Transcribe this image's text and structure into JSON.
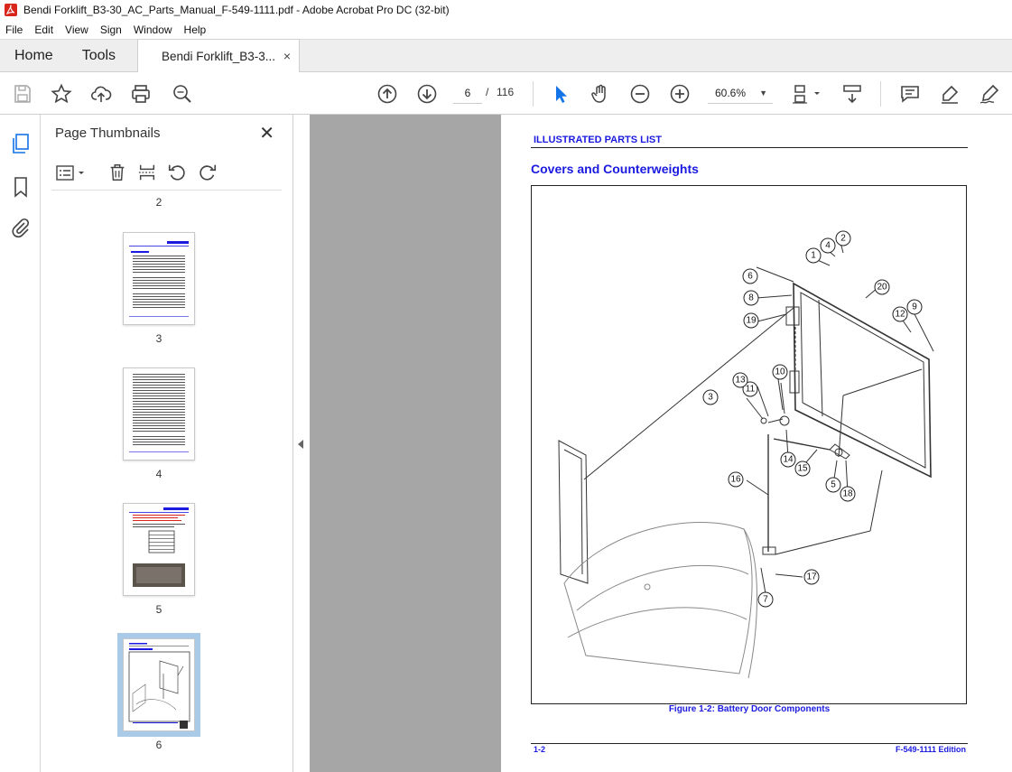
{
  "window": {
    "title": "Bendi Forklift_B3-30_AC_Parts_Manual_F-549-1111.pdf - Adobe Acrobat Pro DC (32-bit)"
  },
  "menu": [
    "File",
    "Edit",
    "View",
    "Sign",
    "Window",
    "Help"
  ],
  "tabs": {
    "home": "Home",
    "tools": "Tools",
    "document": "Bendi Forklift_B3-3...",
    "close": "×"
  },
  "toolbar": {
    "current_page": "6",
    "page_separator": "/",
    "total_pages": "116",
    "zoom": "60.6%",
    "icons": [
      "save-icon",
      "star-icon",
      "cloud-upload-icon",
      "print-icon",
      "find-icon",
      "page-up-icon",
      "page-down-icon",
      "select-arrow-icon",
      "hand-icon",
      "zoom-out-icon",
      "zoom-in-icon",
      "page-fit-icon",
      "scroll-mode-icon",
      "comment-icon",
      "highlight-icon",
      "sign-icon"
    ]
  },
  "thumbnails_panel": {
    "title": "Page Thumbnails",
    "close": "✕",
    "page_labels": [
      "2",
      "3",
      "4",
      "5",
      "6"
    ],
    "selected_page": "6"
  },
  "document_page": {
    "header": "ILLUSTRATED PARTS LIST",
    "section_title": "Covers and Counterweights",
    "figure_caption": "Figure 1-2:  Battery Door Components",
    "footer_left": "1-2",
    "footer_right": "F-549-1111 Edition",
    "callouts": [
      "1",
      "2",
      "3",
      "4",
      "5",
      "6",
      "7",
      "8",
      "9",
      "10",
      "11",
      "12",
      "13",
      "14",
      "15",
      "16",
      "17",
      "18",
      "19",
      "20"
    ]
  },
  "colors": {
    "accent_blue": "#1a1ae0",
    "doc_background": "#a6a6a6",
    "selected_thumb": "#a9cbe7",
    "acrobat_red": "#d9261c"
  }
}
